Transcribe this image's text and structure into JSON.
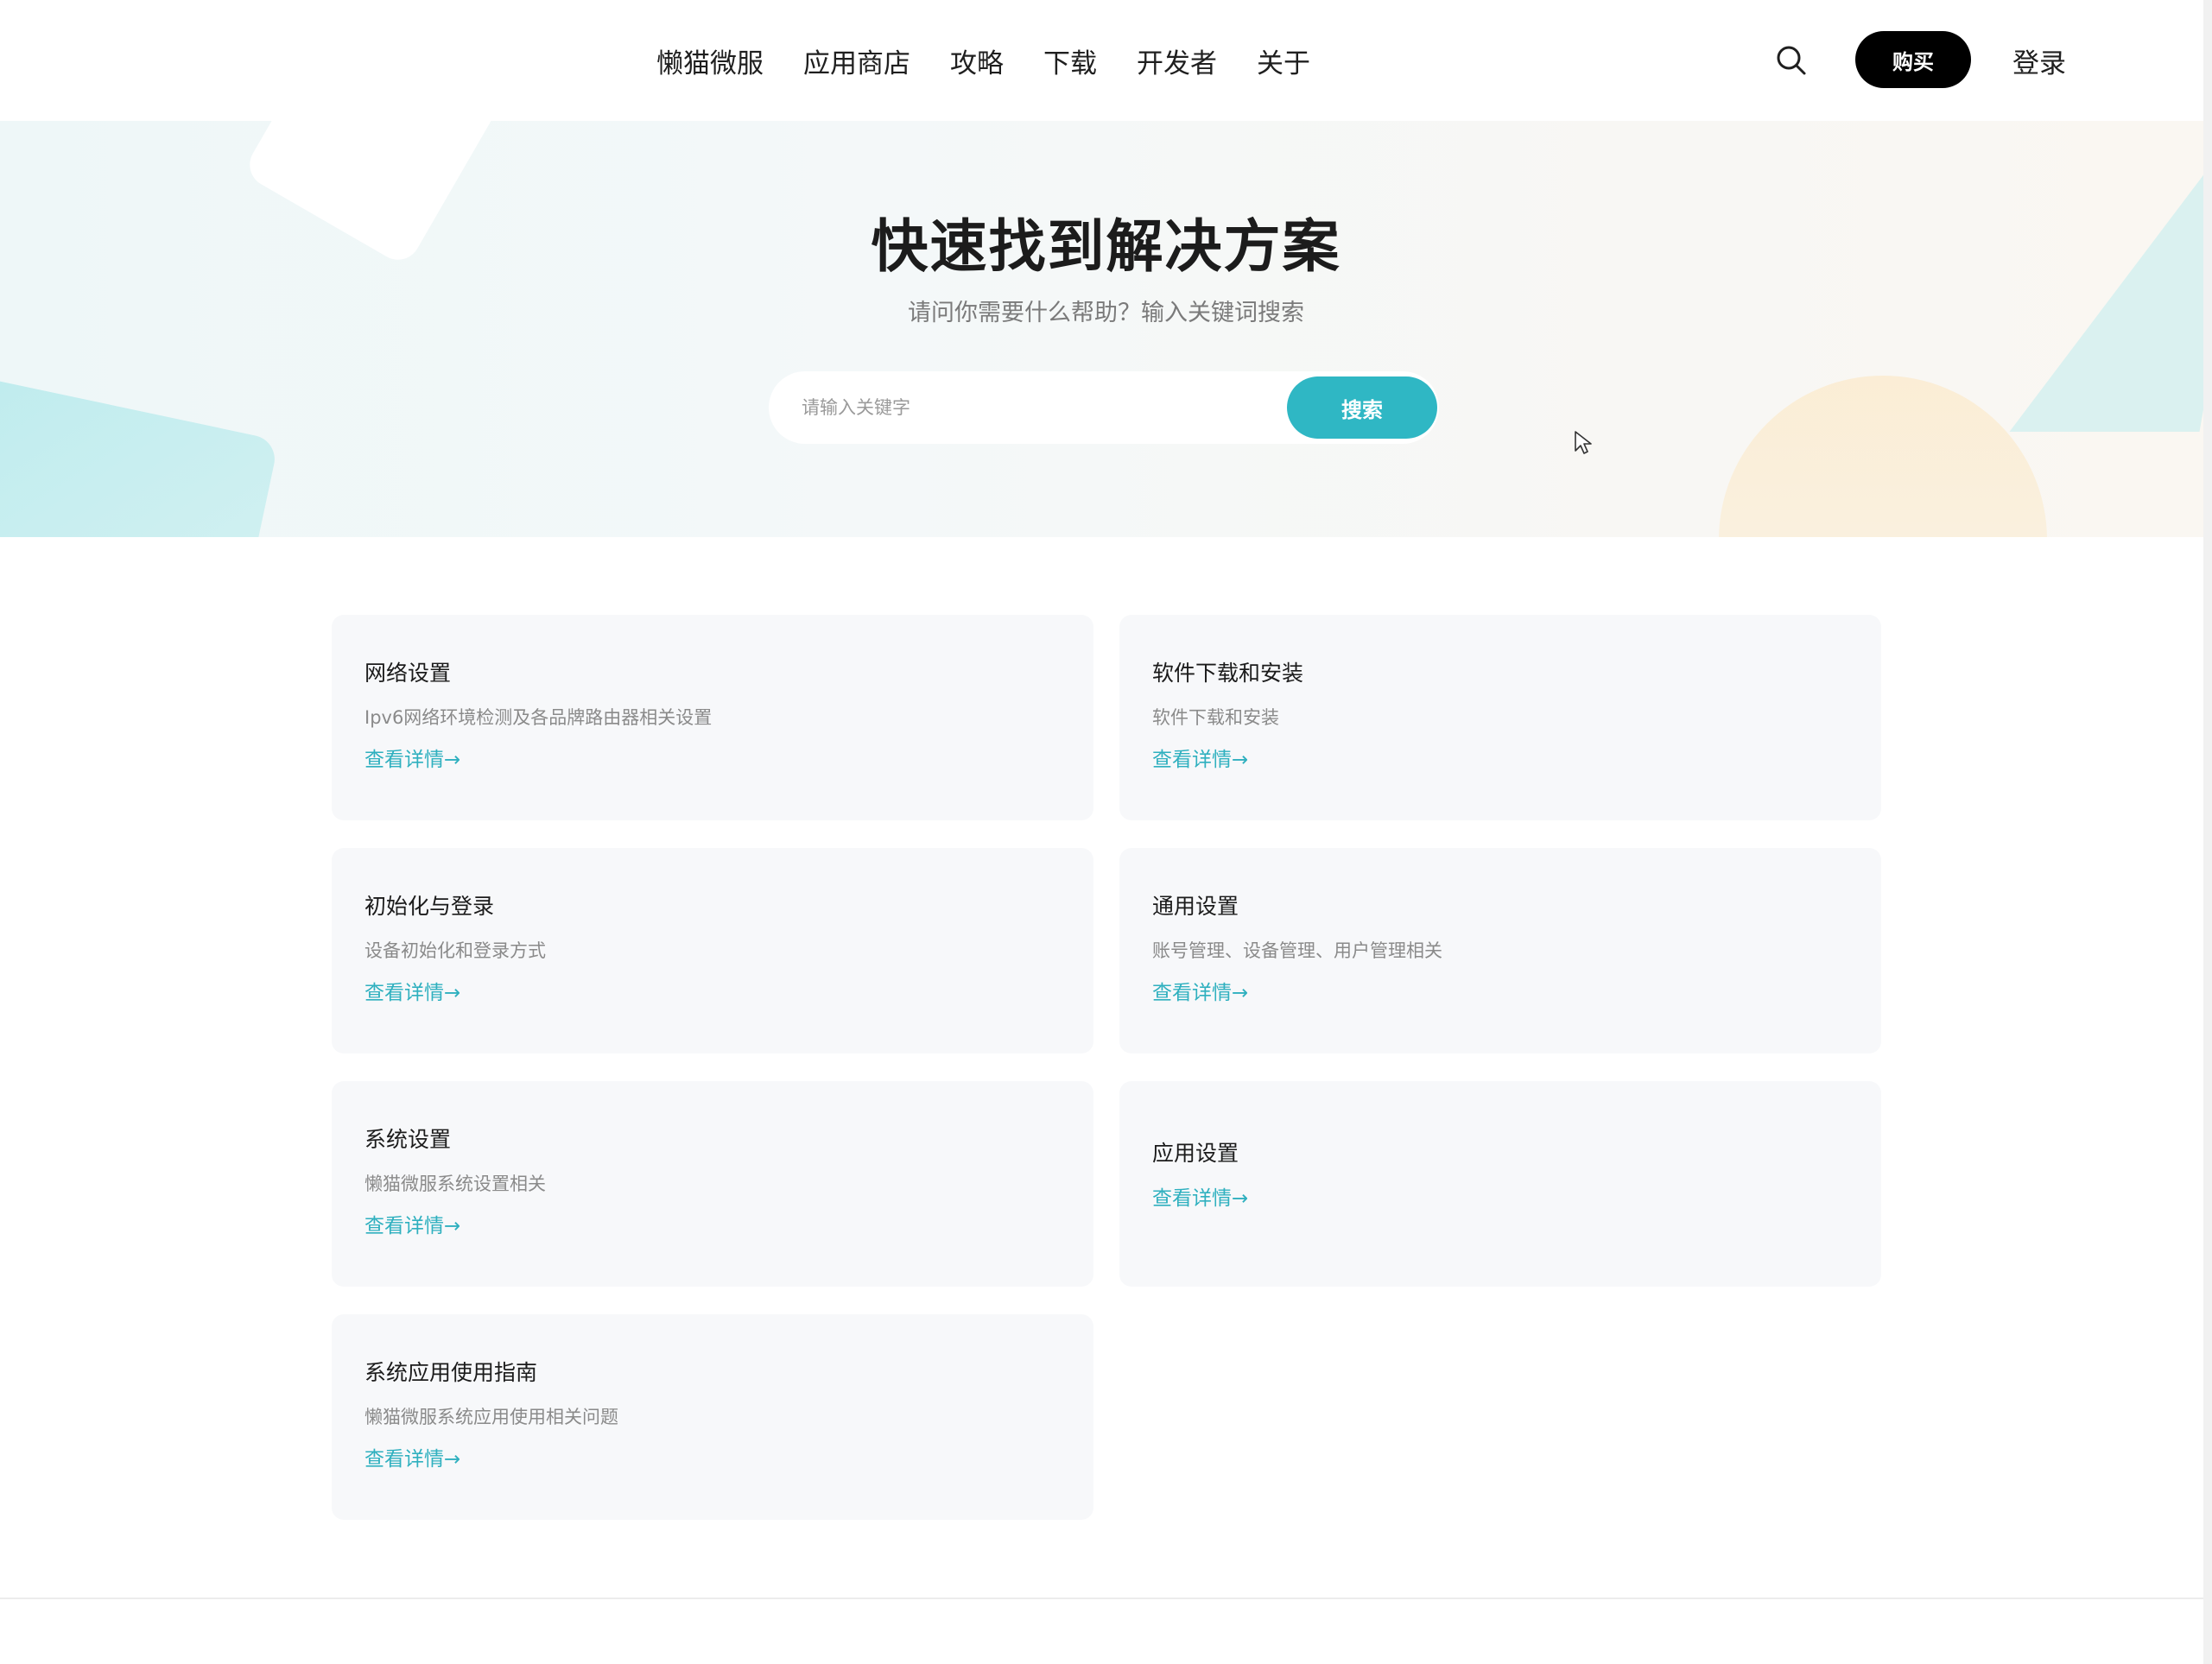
{
  "nav": {
    "items": [
      {
        "label": "懒猫微服"
      },
      {
        "label": "应用商店"
      },
      {
        "label": "攻略"
      },
      {
        "label": "下载"
      },
      {
        "label": "开发者"
      },
      {
        "label": "关于"
      }
    ],
    "search_icon": "search-icon",
    "buy_label": "购买",
    "login_label": "登录"
  },
  "hero": {
    "title": "快速找到解决方案",
    "subtitle": "请问你需要什么帮助？输入关键词搜索",
    "search_placeholder": "请输入关键字",
    "search_value": "",
    "search_button": "搜索"
  },
  "cards": [
    {
      "title": "网络设置",
      "desc": "Ipv6网络环境检测及各品牌路由器相关设置",
      "link": "查看详情→"
    },
    {
      "title": "软件下载和安装",
      "desc": "软件下载和安装",
      "link": "查看详情→"
    },
    {
      "title": "初始化与登录",
      "desc": "设备初始化和登录方式",
      "link": "查看详情→"
    },
    {
      "title": "通用设置",
      "desc": "账号管理、设备管理、用户管理相关",
      "link": "查看详情→"
    },
    {
      "title": "系统设置",
      "desc": "懒猫微服系统设置相关",
      "link": "查看详情→"
    },
    {
      "title": "应用设置",
      "desc": "",
      "link": "查看详情→"
    },
    {
      "title": "系统应用使用指南",
      "desc": "懒猫微服系统应用使用相关问题",
      "link": "查看详情→"
    }
  ],
  "colors": {
    "accent": "#2fb7c4",
    "buy_button": "#000000",
    "card_bg": "#f7f8fa"
  }
}
